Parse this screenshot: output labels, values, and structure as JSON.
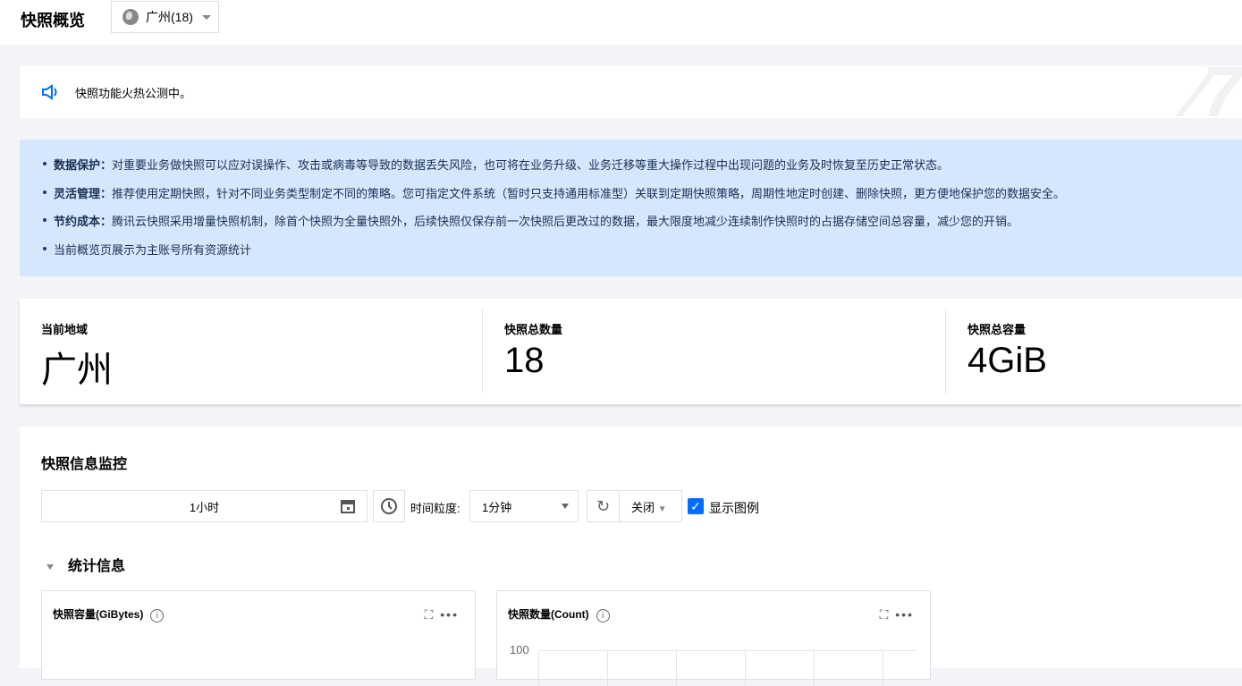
{
  "header": {
    "title": "快照概览",
    "region": "广州(18)"
  },
  "notice": {
    "text": "快照功能火热公测中。"
  },
  "info": [
    {
      "bold": "数据保护：",
      "text": "对重要业务做快照可以应对误操作、攻击或病毒等导致的数据丢失风险，也可将在业务升级、业务迁移等重大操作过程中出现问题的业务及时恢复至历史正常状态。"
    },
    {
      "bold": "灵活管理：",
      "text": "推荐使用定期快照，针对不同业务类型制定不同的策略。您可指定文件系统（暂时只支持通用标准型）关联到定期快照策略，周期性地定时创建、删除快照，更方便地保护您的数据安全。"
    },
    {
      "bold": "节约成本：",
      "text": "腾讯云快照采用增量快照机制，除首个快照为全量快照外，后续快照仅保存前一次快照后更改过的数据，最大限度地减少连续制作快照时的占据存储空间总容量，减少您的开销。"
    },
    {
      "bold": "",
      "text": "当前概览页展示为主账号所有资源统计"
    }
  ],
  "stats": [
    {
      "label": "当前地域",
      "value": "广州"
    },
    {
      "label": "快照总数量",
      "value": "18"
    },
    {
      "label": "快照总容量",
      "value": "4GiB"
    }
  ],
  "monitor": {
    "title": "快照信息监控",
    "time_range": "1小时",
    "granularity_label": "时间粒度:",
    "granularity": "1分钟",
    "refresh": "关闭",
    "show_legend": "显示图例",
    "show_legend_checked": true,
    "section": "统计信息",
    "charts": [
      {
        "title": "快照容量(GiBytes)"
      },
      {
        "title": "快照数量(Count)",
        "y_tick": "100"
      }
    ]
  },
  "colors": {
    "accent": "#006eff",
    "info_bg": "#d5e6fd"
  }
}
